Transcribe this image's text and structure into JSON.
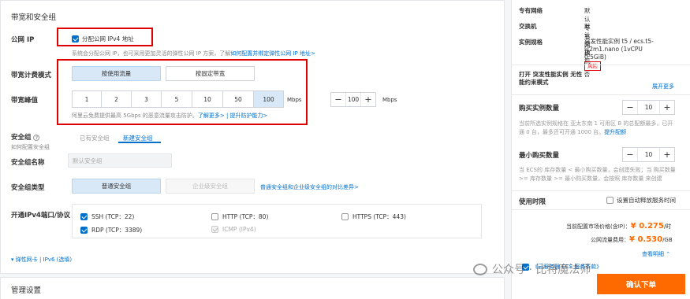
{
  "section": {
    "title": "带宽和安全组",
    "public_ip_label": "公网 IP",
    "assign_ipv4_label": "分配公网 IPv4 地址",
    "public_ip_desc": "系统会分配公网 IP，也可采用更加灵活的弹性公网 IP 方案，了解",
    "public_ip_link": "如何配置并绑定弹性公网 IP 地址>",
    "billing_label": "带宽计费模式",
    "billing_options": [
      "按使用流量",
      "按固定带宽"
    ],
    "bandwidth_label": "带宽峰值",
    "bandwidth_options": [
      "1",
      "2",
      "3",
      "5",
      "10",
      "50",
      "100"
    ],
    "bandwidth_unit": "Mbps",
    "bandwidth_value": "100",
    "bandwidth_unit2": "Mbps",
    "ddos_text": "阿里云免费提供最高 5Gbps 的恶意流量攻击防护。",
    "ddos_link": "了解更多> | 提升防护能力>",
    "sg_label": "安全组",
    "sg_sub": "如何配置安全组",
    "sg_tabs": [
      "已有安全组",
      "新建安全组"
    ],
    "sg_name_label": "安全组名称",
    "sg_name_placeholder": "默认安全组",
    "sg_type_label": "安全组类型",
    "sg_type_options": [
      "普通安全组",
      "企业级安全组"
    ],
    "sg_type_link": "普通安全组和企业级安全组的对比差异>",
    "ports_label": "开通IPv4端口/协议",
    "ports": [
      {
        "label": "SSH (TCP：22)",
        "state": "on"
      },
      {
        "label": "HTTP (TCP：80)",
        "state": "off"
      },
      {
        "label": "HTTPS (TCP：443)",
        "state": "off"
      },
      {
        "label": "RDP (TCP：3389)",
        "state": "on"
      },
      {
        "label": "ICMP (IPv4)",
        "state": "disabled"
      }
    ],
    "eni_link": "弹性网卡 | IPv6 (选填)"
  },
  "lower": {
    "title": "管理设置"
  },
  "summary": {
    "rows": [
      {
        "k": "专有网络",
        "v": "默认专有网络"
      },
      {
        "k": "交换机",
        "v": "默认交换机"
      }
    ],
    "spec_label": "实例规格",
    "spec_value": "突发性能实例 t5 / ecs.t5-lc2m1.nano (1vCPU 0.5GiB)",
    "risk_tag": "风险",
    "burst_line": "打开 突发性能实例 无性",
    "burst_line2": "能约束模式",
    "burst_value": "否",
    "expand": "展开更多",
    "buy_qty_label": "购买实例数量",
    "buy_qty_value": "10",
    "buy_qty_desc": "当前所选实例规格在 亚太东南 1 可用区 B 的总配额最多，已开通 0 台，最多还可开通 1000 台。",
    "buy_qty_link": "提升配额",
    "min_qty_label": "最小购买数量",
    "min_qty_value": "10",
    "min_qty_desc": "当 ECS的 库存数量 < 最小购买数量，会创建失败；当 购买数量 >= 库存数量 >= 最小购买数量，会按照 库存数量 来创建",
    "duration_label": "使用时限",
    "auto_release": "设置自动释放服务时间",
    "market_price_label": "当前配置市场价格(含IP)：",
    "market_price": "¥ 0.275",
    "market_unit": "/时",
    "traffic_label": "公网流量费用：",
    "traffic_price": "¥ 0.530",
    "traffic_unit": "/GB",
    "detail_link": "查看明细",
    "agree_text": "《云服务器 ECS 服务条款》",
    "buy_button": "确认下单"
  },
  "watermark": "公众号 · 比特魔法师"
}
